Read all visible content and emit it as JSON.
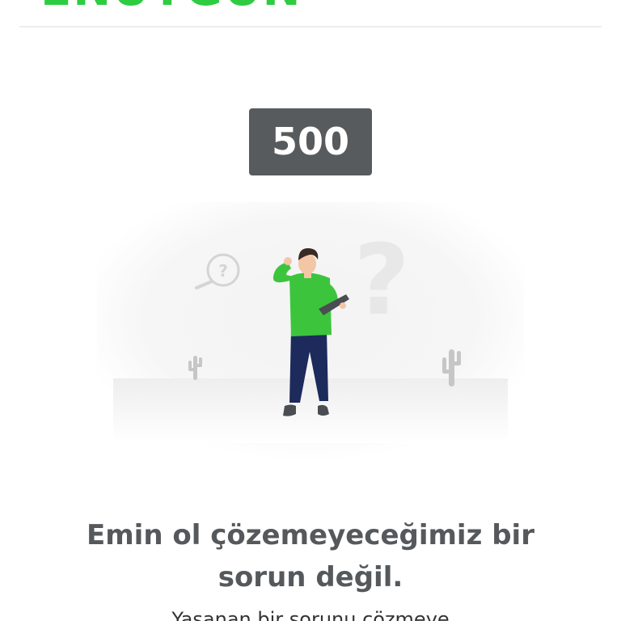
{
  "header": {
    "logo_text": "ENUYGUN"
  },
  "error": {
    "code": "500",
    "headline_line1": "Emin ol çözemeyeceğimiz bir",
    "headline_line2": "sorun değil.",
    "subtext": "Yaşanan bir sorunu çözmeye"
  },
  "illustration": {
    "question_mark": "?"
  },
  "colors": {
    "brand_green": "#2ecc40",
    "badge_bg": "#575b5d",
    "headline": "#55595c",
    "shirt": "#3cc53c",
    "pants": "#1d2a5c"
  }
}
